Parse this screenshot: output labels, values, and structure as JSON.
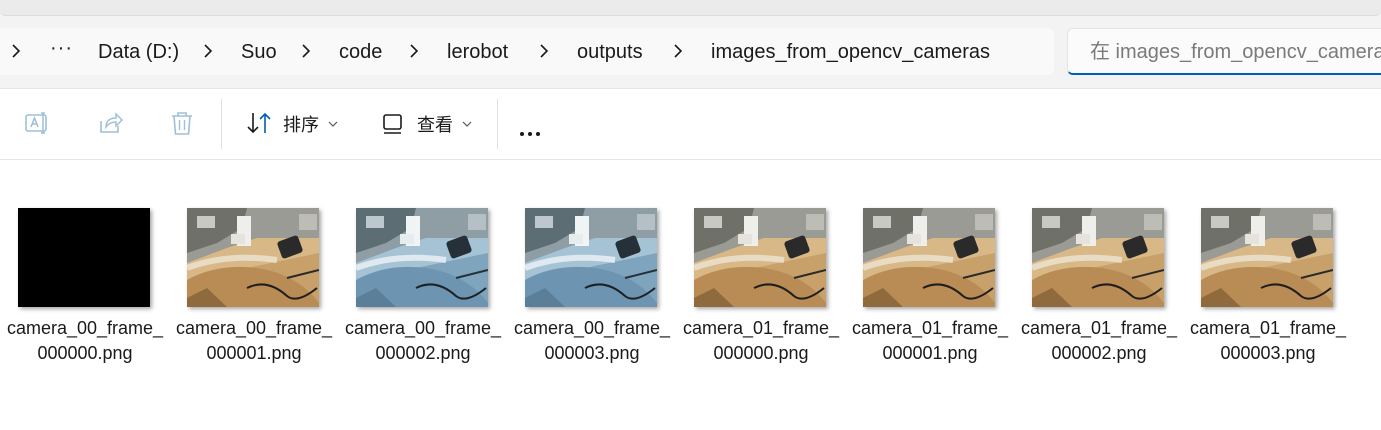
{
  "breadcrumb": {
    "overflow_label": "···",
    "items": [
      "Data (D:)",
      "Suo",
      "code",
      "lerobot",
      "outputs",
      "images_from_opencv_cameras"
    ]
  },
  "search": {
    "placeholder": "在 images_from_opencv_cameras 中搜索"
  },
  "toolbar": {
    "sort_label": "排序",
    "view_label": "查看",
    "icons": [
      "rename-icon",
      "share-icon",
      "delete-icon",
      "sort-icon",
      "view-icon",
      "more-icon"
    ]
  },
  "files": [
    {
      "name": "camera_00_frame_000000.png",
      "variant": "black"
    },
    {
      "name": "camera_00_frame_000001.png",
      "variant": "warm"
    },
    {
      "name": "camera_00_frame_000002.png",
      "variant": "blue"
    },
    {
      "name": "camera_00_frame_000003.png",
      "variant": "blue"
    },
    {
      "name": "camera_01_frame_000000.png",
      "variant": "warm"
    },
    {
      "name": "camera_01_frame_000001.png",
      "variant": "warm"
    },
    {
      "name": "camera_01_frame_000002.png",
      "variant": "warm"
    },
    {
      "name": "camera_01_frame_000003.png",
      "variant": "warm"
    }
  ],
  "colors": {
    "accent": "#005fb8",
    "toolbar_icon_disabled": "#9dbfd8"
  }
}
